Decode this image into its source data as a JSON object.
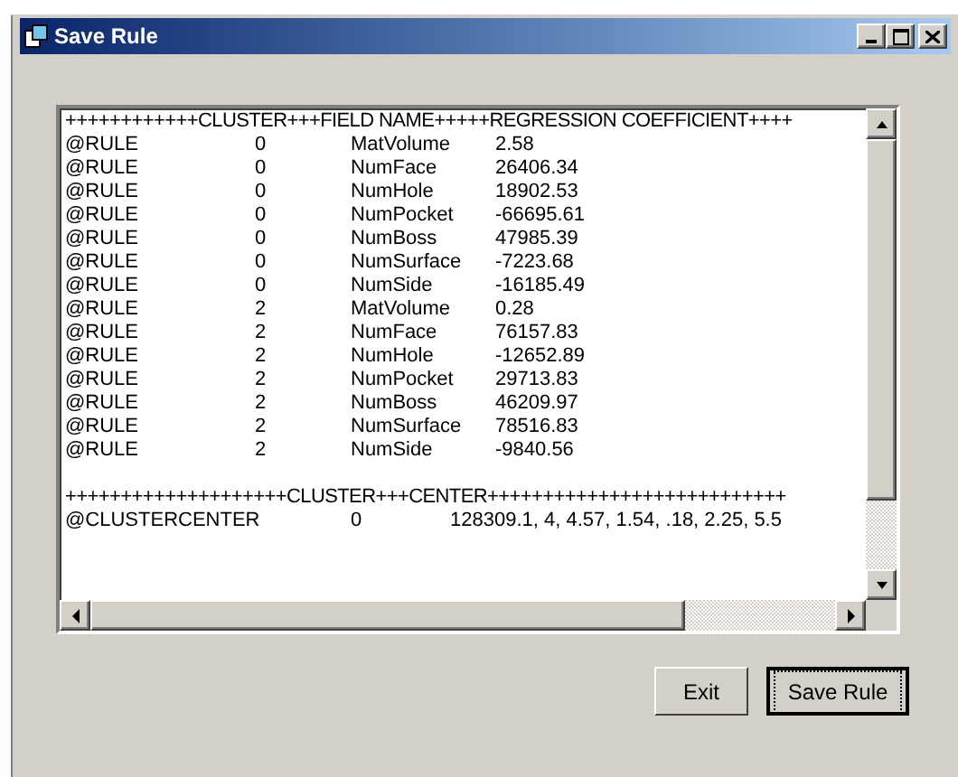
{
  "window": {
    "title": "Save Rule"
  },
  "rule_header": "++++++++++++CLUSTER+++FIELD NAME+++++REGRESSION COEFFICIENT++++",
  "rules": [
    {
      "label": "@RULE",
      "cluster": "0",
      "field": "MatVolume",
      "coefficient": "2.58"
    },
    {
      "label": "@RULE",
      "cluster": "0",
      "field": "NumFace",
      "coefficient": "26406.34"
    },
    {
      "label": "@RULE",
      "cluster": "0",
      "field": "NumHole",
      "coefficient": "18902.53"
    },
    {
      "label": "@RULE",
      "cluster": "0",
      "field": "NumPocket",
      "coefficient": "-66695.61"
    },
    {
      "label": "@RULE",
      "cluster": "0",
      "field": "NumBoss",
      "coefficient": "47985.39"
    },
    {
      "label": "@RULE",
      "cluster": "0",
      "field": "NumSurface",
      "coefficient": "-7223.68"
    },
    {
      "label": "@RULE",
      "cluster": "0",
      "field": "NumSide",
      "coefficient": "-16185.49"
    },
    {
      "label": "@RULE",
      "cluster": "2",
      "field": "MatVolume",
      "coefficient": "0.28"
    },
    {
      "label": "@RULE",
      "cluster": "2",
      "field": "NumFace",
      "coefficient": "76157.83"
    },
    {
      "label": "@RULE",
      "cluster": "2",
      "field": "NumHole",
      "coefficient": "-12652.89"
    },
    {
      "label": "@RULE",
      "cluster": "2",
      "field": "NumPocket",
      "coefficient": "29713.83"
    },
    {
      "label": "@RULE",
      "cluster": "2",
      "field": "NumBoss",
      "coefficient": "46209.97"
    },
    {
      "label": "@RULE",
      "cluster": "2",
      "field": "NumSurface",
      "coefficient": "78516.83"
    },
    {
      "label": "@RULE",
      "cluster": "2",
      "field": "NumSide",
      "coefficient": "-9840.56"
    }
  ],
  "center_header": "++++++++++++++++++++CLUSTER+++CENTER+++++++++++++++++++++++++++",
  "centers": [
    {
      "label": "@CLUSTERCENTER",
      "cluster": "0",
      "values": "128309.1, 4, 4.57, 1.54, .18, 2.25, 5.5"
    }
  ],
  "buttons": [
    {
      "label": "Exit",
      "focused": false
    },
    {
      "label": "Save Rule",
      "focused": true
    }
  ]
}
